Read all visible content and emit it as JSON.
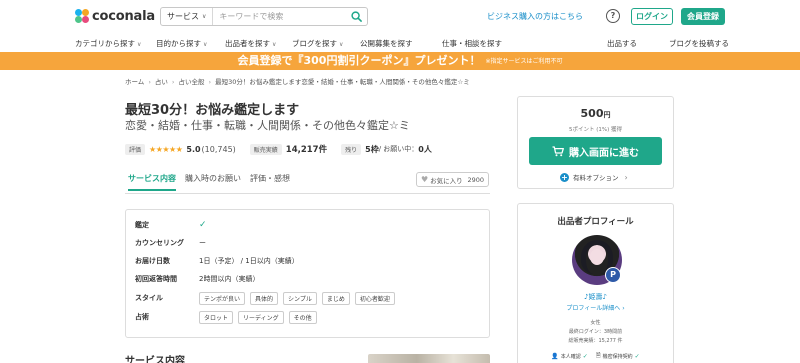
{
  "header": {
    "logo_text": "coconala",
    "search": {
      "category": "サービス",
      "placeholder": "キーワードで検索"
    },
    "business_link": "ビジネス購入の方はこちら",
    "help_glyph": "?",
    "login_label": "ログイン",
    "register_label": "会員登録"
  },
  "nav": {
    "items": [
      "カテゴリから探す",
      "目的から探す",
      "出品者を探す",
      "ブログを探す",
      "公開募集を探す",
      "仕事・相談を探す",
      "出品する",
      "ブログを投稿する"
    ]
  },
  "banner": {
    "main": "会員登録で『300円割引クーポン』プレゼント！",
    "note": "※指定サービスはご利用不可"
  },
  "breadcrumb": [
    "ホーム",
    "占い",
    "占い全般",
    "最短30分！お悩み鑑定します恋愛・結婚・仕事・転職・人間関係・その他色々鑑定☆ミ"
  ],
  "service": {
    "title": "最短30分！お悩み鑑定します",
    "subtitle": "恋愛・結婚・仕事・転職・人間関係・その他色々鑑定☆ミ",
    "stats": {
      "rating_label": "評価",
      "stars": "★★★★★",
      "rating": "5.0",
      "rating_count": "(10,745)",
      "sales_label": "販売実績",
      "sales_value": "14,217件",
      "remaining_label": "残り",
      "remaining_value": "5枠",
      "inquiry_label": "/ お願い中：",
      "inquiry_value": "0人"
    }
  },
  "tabs": [
    "サービス内容",
    "購入時のお願い",
    "評価・感想"
  ],
  "favorite": {
    "label": "お気に入り",
    "count": "2900"
  },
  "details": {
    "rows": [
      {
        "label": "鑑定",
        "value": "✓"
      },
      {
        "label": "カウンセリング",
        "value": "ー"
      },
      {
        "label": "お届け日数",
        "value": "1日（予定） / 1日以内（実績）"
      },
      {
        "label": "初回返答時間",
        "value": "2時間以内（実績）"
      },
      {
        "label": "スタイル",
        "chips": [
          "テンポが良い",
          "具体的",
          "シンプル",
          "まじめ",
          "初心者歓迎"
        ]
      },
      {
        "label": "占術",
        "chips": [
          "タロット",
          "リーディング",
          "その他"
        ]
      }
    ]
  },
  "section_title": "サービス内容",
  "purchase": {
    "price": "500",
    "currency": "円",
    "points": "5ポイント (1%) 獲得",
    "buy_label": "購入画面に進む",
    "option_plus": "+",
    "option_label": "有料オプション",
    "option_arrow": "›"
  },
  "profile": {
    "title": "出品者プロフィール",
    "rank_badge": "P",
    "name": "♪姫壽♪",
    "detail_link": "プロフィール詳細へ ›",
    "gender": "女性",
    "last_login": "最終ログイン：3時間前",
    "total_sales": "総販売実績：15,277 件",
    "verified_1": "本人確認",
    "verified_2": "機密保持契約",
    "verified_icon_1": "👤",
    "verified_icon_2": "🗎",
    "check": "✓"
  },
  "colors": {
    "brand_green": "#1fa78a",
    "link_blue": "#1a8fc9",
    "banner_orange": "#f6a53c",
    "star": "#f5a623"
  }
}
